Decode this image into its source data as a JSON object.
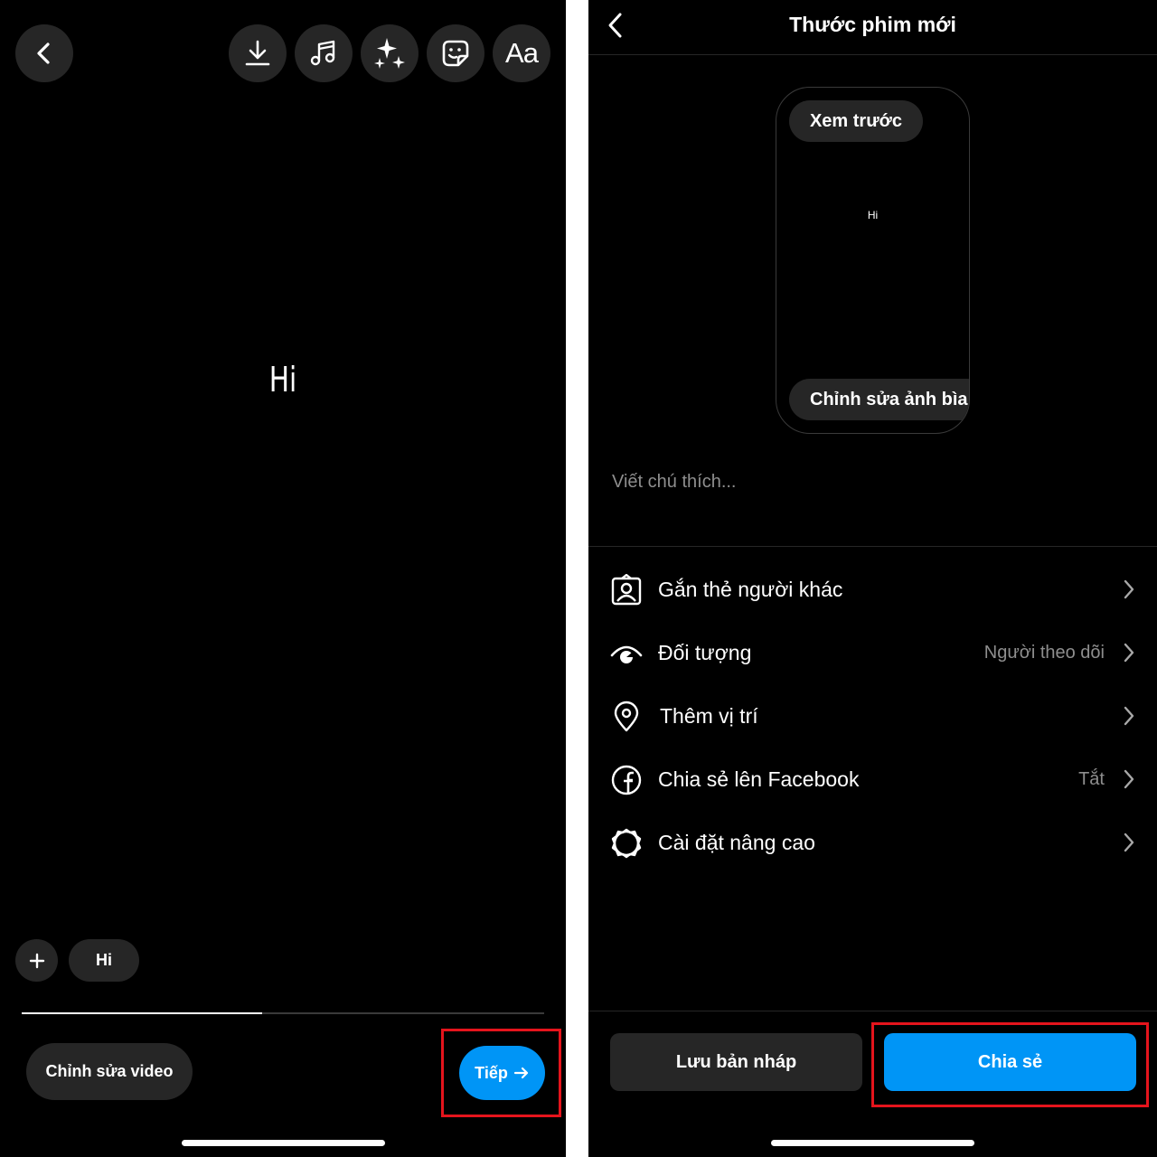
{
  "editor": {
    "canvas_text": "Hi",
    "text_chip": "Hi",
    "edit_video_label": "Chỉnh sửa video",
    "next_label": "Tiếp",
    "toolbar": {
      "icons": [
        "back-icon",
        "download-icon",
        "music-icon",
        "sparkle-effects-icon",
        "sticker-icon",
        "text-icon"
      ],
      "text_tool_label": "Aa"
    },
    "timeline_progress": 0.46
  },
  "new_reel": {
    "title": "Thước phim mới",
    "preview": {
      "preview_button": "Xem trước",
      "text": "Hi",
      "edit_cover_button": "Chỉnh sửa ảnh bìa"
    },
    "caption_placeholder": "Viết chú thích...",
    "options": [
      {
        "icon": "tag-people-icon",
        "label": "Gắn thẻ người khác",
        "value": ""
      },
      {
        "icon": "audience-eye-icon",
        "label": "Đối tượng",
        "value": "Người theo dõi"
      },
      {
        "icon": "location-pin-icon",
        "label": "Thêm vị trí",
        "value": ""
      },
      {
        "icon": "facebook-icon",
        "label": "Chia sẻ lên Facebook",
        "value": "Tắt"
      },
      {
        "icon": "settings-gear-icon",
        "label": "Cài đặt nâng cao",
        "value": ""
      }
    ],
    "save_draft_label": "Lưu bản nháp",
    "share_label": "Chia sẻ"
  },
  "colors": {
    "accent_blue": "#0095f6",
    "highlight_red": "#e5141c",
    "dark_surface": "#262626",
    "secondary_text": "#8e8e8e"
  }
}
